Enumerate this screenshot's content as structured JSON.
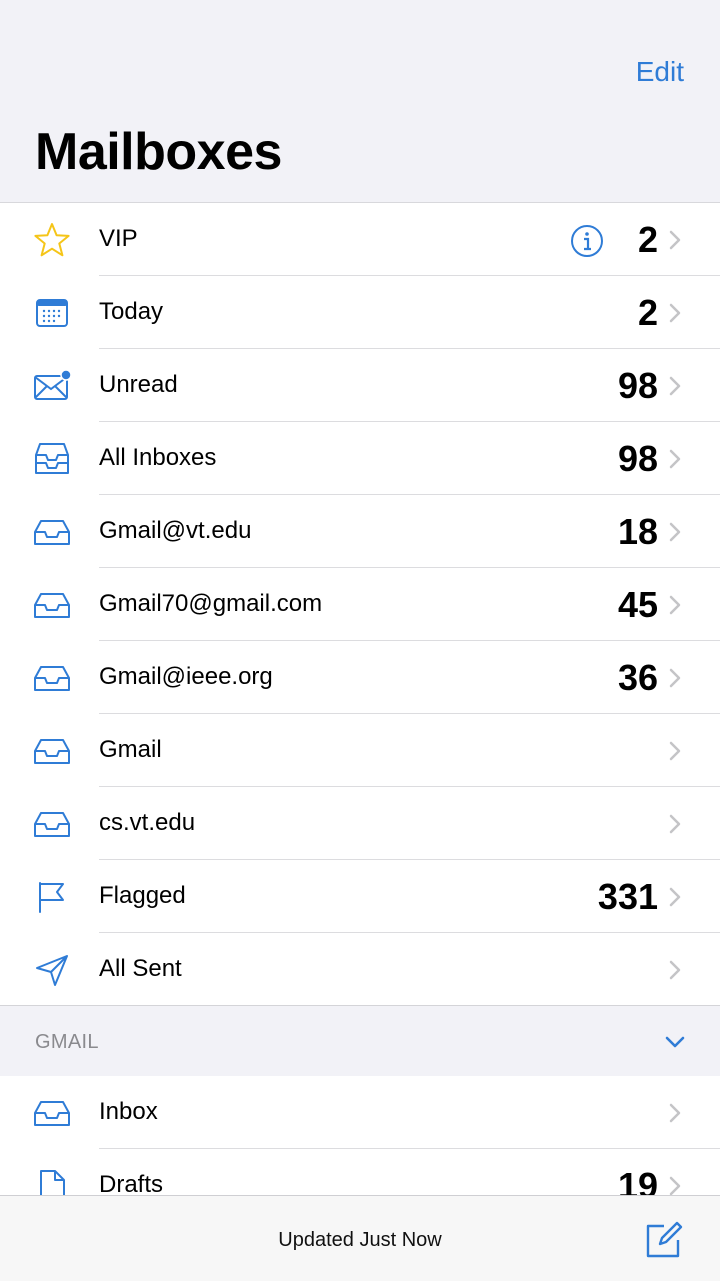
{
  "header": {
    "edit_label": "Edit",
    "title": "Mailboxes"
  },
  "mailboxes": [
    {
      "label": "VIP",
      "count": "2",
      "icon": "star-icon",
      "has_info": true
    },
    {
      "label": "Today",
      "count": "2",
      "icon": "calendar-icon"
    },
    {
      "label": "Unread",
      "count": "98",
      "icon": "unread-envelope-icon"
    },
    {
      "label": "All Inboxes",
      "count": "98",
      "icon": "all-inboxes-icon"
    },
    {
      "label": "Gmail@vt.edu",
      "count": "18",
      "icon": "inbox-tray-icon"
    },
    {
      "label": "Gmail70@gmail.com",
      "count": "45",
      "icon": "inbox-tray-icon"
    },
    {
      "label": "Gmail@ieee.org",
      "count": "36",
      "icon": "inbox-tray-icon"
    },
    {
      "label": "Gmail",
      "count": "",
      "icon": "inbox-tray-icon"
    },
    {
      "label": "cs.vt.edu",
      "count": "",
      "icon": "inbox-tray-icon"
    },
    {
      "label": "Flagged",
      "count": "331",
      "icon": "flag-icon"
    },
    {
      "label": "All Sent",
      "count": "",
      "icon": "paper-plane-icon"
    }
  ],
  "section": {
    "title": "GMAIL",
    "items": [
      {
        "label": "Inbox",
        "count": "",
        "icon": "inbox-tray-icon"
      },
      {
        "label": "Drafts",
        "count": "19",
        "icon": "document-icon"
      }
    ]
  },
  "toolbar": {
    "status": "Updated Just Now",
    "compose_icon": "compose-icon"
  },
  "colors": {
    "accent": "#2f7cd6",
    "star": "#f5c518",
    "background": "#f2f2f7"
  }
}
